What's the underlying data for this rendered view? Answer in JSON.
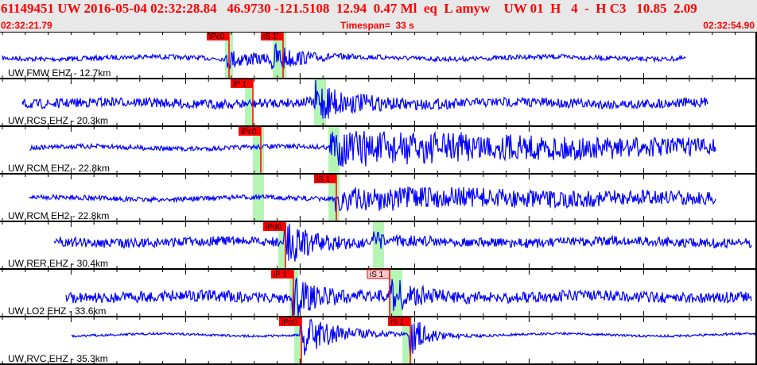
{
  "header": {
    "title": "61149451 UW 2016-05-04 02:32:28.84   46.9730 -121.5108  12.94  0.47 Ml  eq  L amyw    UW 01  H   4  -  H C3   10.85  2.09",
    "start_time": "02:32:21.79",
    "timespan": "Timespan=  33 s",
    "end_time": "02:32:54.90"
  },
  "colors": {
    "waveform": "#0000ff",
    "pick": "#ff0000",
    "pick_unconfirmed": "#ffc8c8",
    "pick_window": "#b4f5b4",
    "header_bg": "#e8e8e8",
    "header_text": "#ff0000"
  },
  "traces": [
    {
      "label": "UW FMW EHZ - 12.7km",
      "picks": [
        {
          "phase": "iPc0"
        },
        {
          "phase": "iS 1"
        }
      ]
    },
    {
      "label": "UW RCS EHZ - 20.3km",
      "picks": [
        {
          "phase": "iP 1"
        }
      ]
    },
    {
      "label": "UW RCM EHZ - 22.8km",
      "picks": [
        {
          "phase": "iPc0"
        }
      ]
    },
    {
      "label": "UW RCM EH2 - 22.8km",
      "picks": [
        {
          "phase": "iS 1"
        }
      ]
    },
    {
      "label": "UW RER EHZ - 30.4km",
      "picks": [
        {
          "phase": "iPd0"
        }
      ]
    },
    {
      "label": "UW LO2 EHZ - 33.6km",
      "picks": [
        {
          "phase": "iP 1"
        },
        {
          "phase": "iS 1",
          "unconfirmed": true
        }
      ]
    },
    {
      "label": "UW RVC EHZ - 35.3km",
      "picks": [
        {
          "phase": "iPc0"
        },
        {
          "phase": "iS 1"
        }
      ]
    }
  ]
}
